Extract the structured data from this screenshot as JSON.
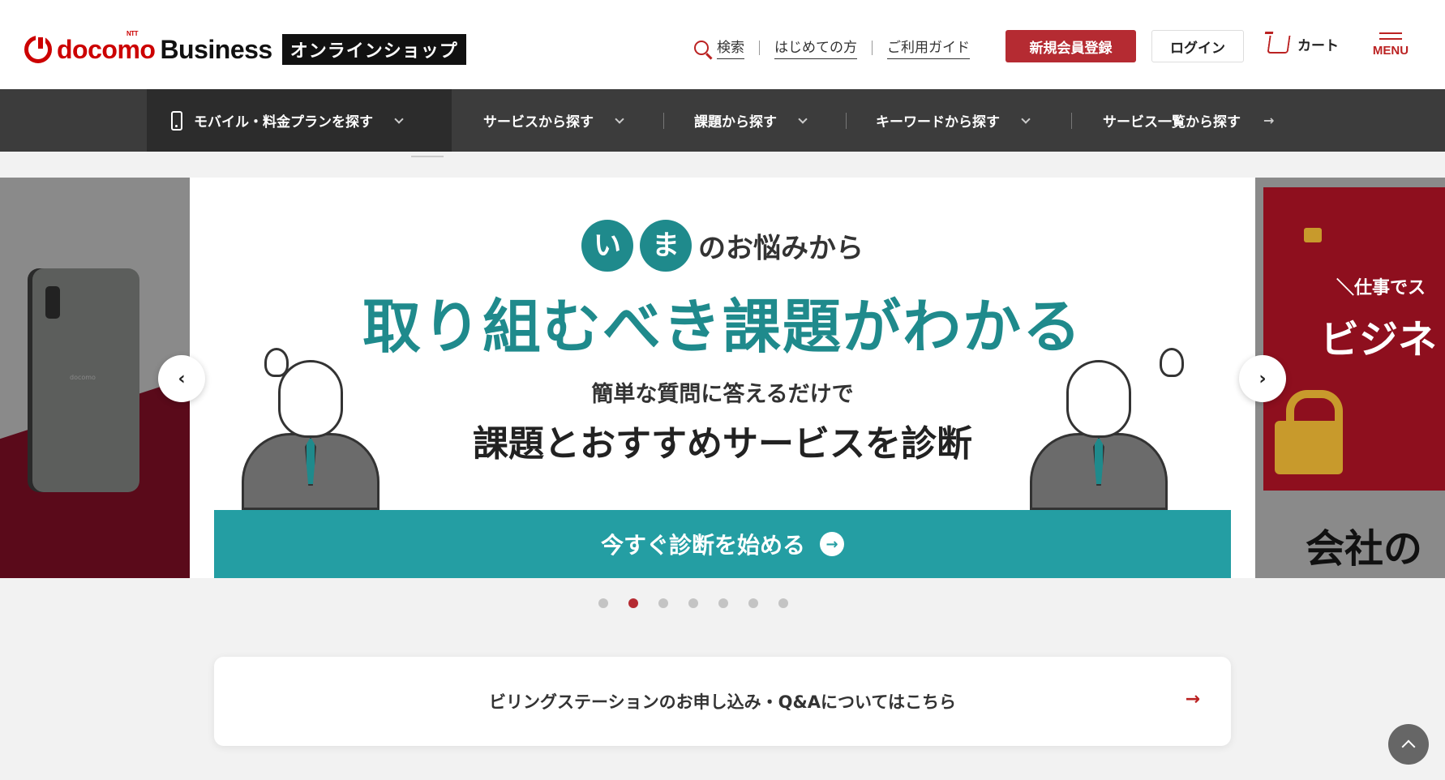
{
  "header": {
    "logo": {
      "ntt": "NTT",
      "docomo": "docomo",
      "business": "Business",
      "shop": "オンラインショップ"
    },
    "search_label": "検索",
    "first_time_label": "はじめての方",
    "guide_label": "ご利用ガイド",
    "register_label": "新規会員登録",
    "login_label": "ログイン",
    "cart_label": "カート",
    "menu_label": "MENU"
  },
  "category_nav": {
    "items": [
      {
        "label": "モバイル・料金プランを探す"
      },
      {
        "label": "サービスから探す"
      },
      {
        "label": "課題から探す"
      },
      {
        "label": "キーワードから探す"
      },
      {
        "label": "サービス一覧から探す"
      }
    ]
  },
  "carousel": {
    "main_slide": {
      "circle1": "い",
      "circle2": "ま",
      "headline_top_rest": "のお悩みから",
      "headline": "取り組むべき課題がわかる",
      "sub1": "簡単な質問に答えるだけで",
      "sub2": "課題とおすすめサービスを診断",
      "cta_label": "今すぐ診断を始める"
    },
    "right_slide": {
      "text1": "＼仕事でス",
      "text2": "ビジネ",
      "text3": "会社の"
    },
    "left_slide": {
      "brand": "docomo"
    },
    "active_dot": 1,
    "dot_count": 7
  },
  "info_card": {
    "label": "ビリングステーションのお申し込み・Q&Aについてはこちら"
  },
  "colors": {
    "brand_red": "#b52b32",
    "teal": "#249ea3",
    "nav_dark": "#3c3c3c"
  }
}
